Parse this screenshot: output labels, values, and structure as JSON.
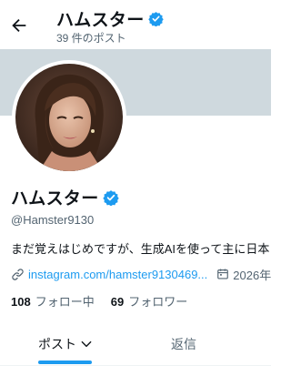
{
  "header": {
    "display_name": "ハムスター",
    "post_count_label": "39 件のポスト"
  },
  "profile": {
    "display_name": "ハムスター",
    "handle": "@Hamster9130",
    "bio": "まだ覚えはじめですが、生成AIを使って主に日本",
    "link": "instagram.com/hamster9130469...",
    "joined": "2026年",
    "following_count": "108",
    "following_label": "フォロー中",
    "followers_count": "69",
    "followers_label": "フォロワー"
  },
  "tabs": [
    {
      "label": "ポスト",
      "selected": true
    },
    {
      "label": "返信",
      "selected": false
    }
  ],
  "icons": {
    "back": "arrow-left-icon",
    "verified": "verified-badge-icon",
    "link": "link-icon",
    "calendar": "calendar-icon",
    "dropdown": "chevron-down-icon"
  },
  "colors": {
    "accent": "#1d9bf0",
    "banner": "#cfd9de",
    "text_primary": "#0f1419",
    "text_secondary": "#536471"
  }
}
